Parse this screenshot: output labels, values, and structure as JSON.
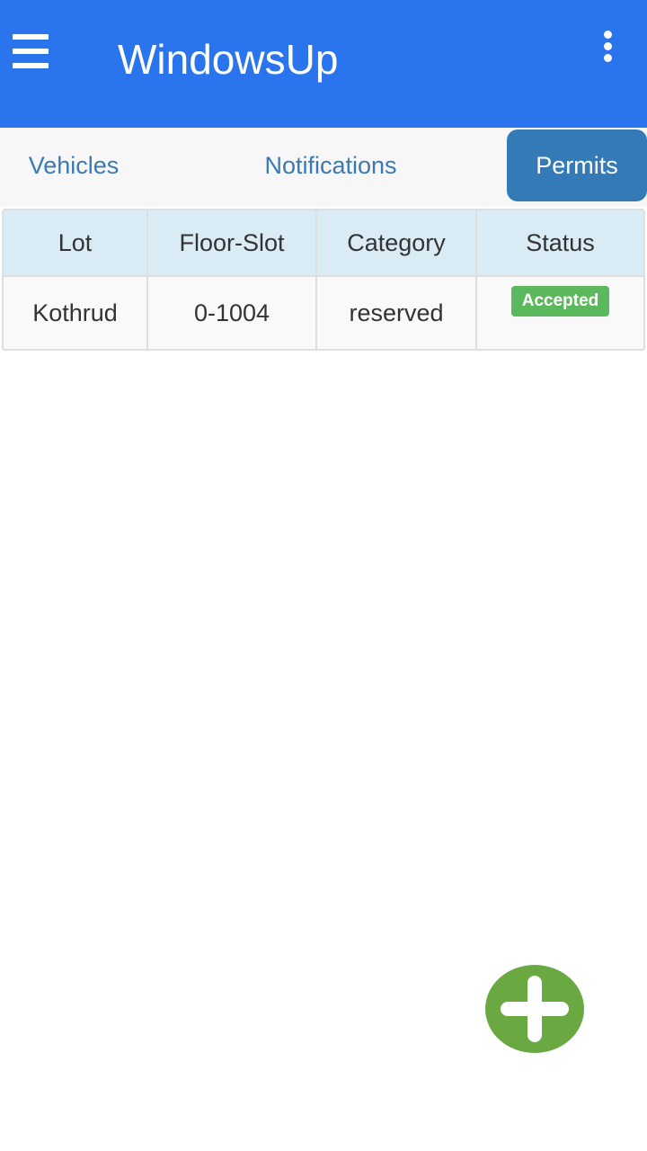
{
  "app": {
    "title": "WindowsUp",
    "menu_icon": "hamburger-menu-icon",
    "overflow_icon": "more-vertical-icon",
    "header_color": "#2a74ee"
  },
  "tabs": [
    {
      "label": "Vehicles",
      "active": false
    },
    {
      "label": "Notifications",
      "active": false
    },
    {
      "label": "Permits",
      "active": true
    }
  ],
  "permits_table": {
    "columns": [
      "Lot",
      "Floor-Slot",
      "Category",
      "Status"
    ],
    "rows": [
      {
        "lot": "Kothrud",
        "floor_slot": "0-1004",
        "category": "reserved",
        "status": "Accepted"
      }
    ]
  },
  "fab": {
    "icon": "plus-icon",
    "color": "#6aa842"
  },
  "colors": {
    "accent": "#337ab7",
    "status_accepted": "#5cb85c",
    "table_header_bg": "#d9ebf5"
  }
}
